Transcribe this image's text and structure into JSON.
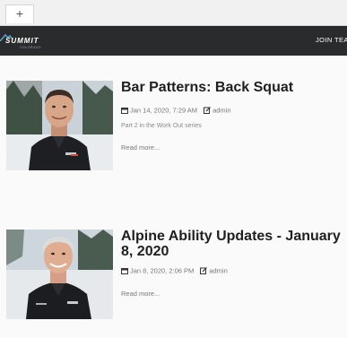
{
  "browser": {
    "new_tab_label": "+"
  },
  "nav": {
    "logo_text": "SUMMIT",
    "logo_subtext": "COLORADO",
    "join_label": "JOIN TEA"
  },
  "posts": [
    {
      "title": "Bar Patterns: Back Squat",
      "date": "Jan 14, 2020, 7:29 AM",
      "author": "admin",
      "excerpt": "Part 2 in the Work Out series",
      "read_more": "Read more..."
    },
    {
      "title": "Alpine Ability Updates - January 8, 2020",
      "date": "Jan 8, 2020, 2:06 PM",
      "author": "admin",
      "read_more": "Read more..."
    }
  ],
  "colors": {
    "navbar": "#2a2b2d",
    "title": "#202020",
    "meta": "#777777",
    "accent_logo": "#5fa8d3"
  }
}
